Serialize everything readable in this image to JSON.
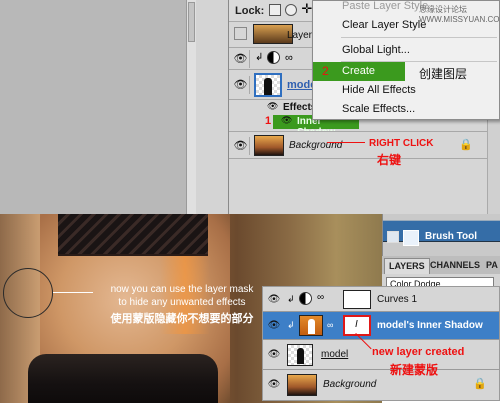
{
  "layers_panel_top": {
    "lock_label": "Lock:",
    "layer_tail": "Layer",
    "model_layer": "model",
    "effects_label": "Effects",
    "inner_shadow": "Inner Shadow",
    "background": "Background"
  },
  "context_menu": {
    "items": [
      {
        "label": "Paste Layer Style",
        "disabled": true
      },
      {
        "label": "Clear Layer Style",
        "disabled": false
      },
      {
        "label": "Global Light...",
        "disabled": false
      },
      {
        "label": "Create Layer",
        "disabled": false,
        "highlighted": true
      },
      {
        "label": "Hide All Effects",
        "disabled": false
      },
      {
        "label": "Scale Effects...",
        "disabled": false
      }
    ]
  },
  "watermark": "思缘设计论坛 WWW.MISSYUAN.COM",
  "annotations": {
    "step1": "1",
    "step2": "2",
    "create_layer_zh": "创建图层",
    "right_click": "RIGHT CLICK",
    "right_click_zh": "右键",
    "mask_note": "now you can use the layer mask\nto hide any unwanted effects",
    "mask_note_zh": "使用蒙版隐藏你不想要的部分",
    "new_layer": "new layer created",
    "new_layer_zh": "新建蒙版"
  },
  "brush_panel": {
    "label": "Brush Tool"
  },
  "layers_panel_bottom": {
    "tabs": [
      "LAYERS",
      "CHANNELS",
      "PA"
    ],
    "blend_mode": "Color Dodge",
    "layers": [
      {
        "name": "Curves 1"
      },
      {
        "name": "model's Inner Shadow"
      },
      {
        "name": "model"
      },
      {
        "name": "Background"
      }
    ]
  },
  "colors": {
    "menu_highlight": "#3b9a1e",
    "selected_layer": "#3d7fc7",
    "annotation_red": "#ee1111"
  }
}
